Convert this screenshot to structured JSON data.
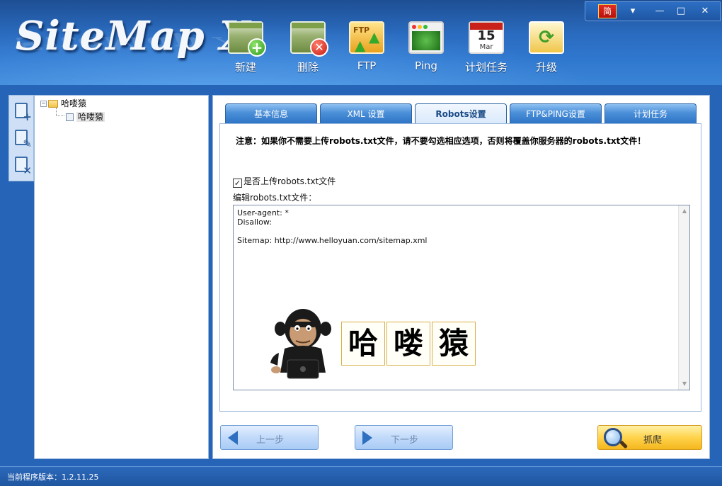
{
  "app": {
    "logo_text": "SiteMap X",
    "version_label": "当前程序版本：1.2.11.25"
  },
  "window_controls": {
    "lang": "简",
    "restore": "▾",
    "minimize": "—",
    "maximize": "□",
    "close": "✕"
  },
  "toolbar": {
    "new": "新建",
    "delete": "删除",
    "ftp": "FTP",
    "ftp_icon_text": "FTP",
    "ping": "Ping",
    "schedule": "计划任务",
    "calendar_day": "15",
    "calendar_month": "Mar",
    "upgrade": "升级"
  },
  "tree": {
    "root": "哈喽猿",
    "child": "哈喽猿"
  },
  "tabs": [
    "基本信息",
    "XML 设置",
    "Robots设置",
    "FTP&PING设置",
    "计划任务"
  ],
  "active_tab": 2,
  "robots_panel": {
    "notice": "注意：如果你不需要上传robots.txt文件，请不要勾选相应选项，否则将覆盖你服务器的robots.txt文件！",
    "upload_checkbox_label": "是否上传robots.txt文件",
    "upload_checked": true,
    "edit_label": "编辑robots.txt文件：",
    "robots_content": "User-agent: *\nDisallow:\n\nSitemap: http://www.helloyuan.com/sitemap.xml",
    "watermark_chars": [
      "哈",
      "喽",
      "猿"
    ]
  },
  "nav": {
    "prev": "上一步",
    "next": "下一步",
    "crawl": "抓爬"
  },
  "colors": {
    "header_blue": "#2a6bbf",
    "tab_blue": "#4a8fd8",
    "crawl_yellow": "#ffd34c"
  }
}
